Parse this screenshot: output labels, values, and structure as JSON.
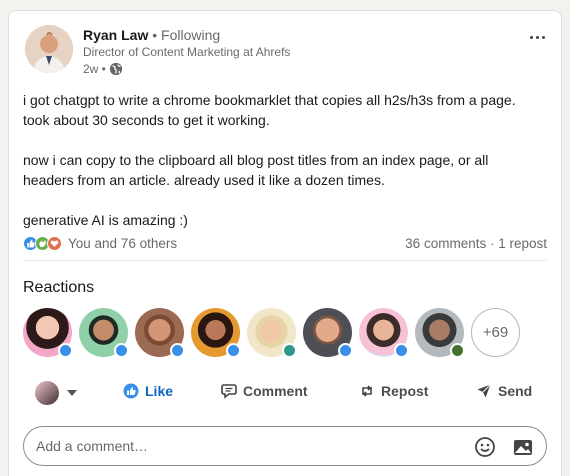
{
  "post": {
    "author_name": "Ryan Law",
    "following": "• Following",
    "headline": "Director of Content Marketing at Ahrefs",
    "time": "2w •",
    "visibility_icon": "globe-icon",
    "body": [
      "i got chatgpt to write a chrome bookmarklet that copies all h2s/h3s from a page. took about 30 seconds to get it working.",
      "now i can copy to the clipboard all blog post titles from an index page, or all headers from an article. already used it like a dozen times.",
      "generative AI is amazing :)"
    ],
    "body_lines": [
      "i got chatgpt to write a chrome bookmarklet that copies all h2s/h3s from a page.",
      "took about 30 seconds to get it working.",
      "now i can copy to the clipboard all blog post titles from an index page, or all",
      "headers from an article. already used it like a dozen times.",
      "generative AI is amazing :)"
    ]
  },
  "social": {
    "reactors": "You and 76 others",
    "comments": "36 comments",
    "separator": " · ",
    "reposts": "1 repost",
    "reaction_types": [
      "like",
      "celebrate",
      "love"
    ]
  },
  "reactions": {
    "title": "Reactions",
    "more_count": "+69"
  },
  "actions": {
    "like": "Like",
    "comment": "Comment",
    "repost": "Repost",
    "send": "Send"
  },
  "comment_box": {
    "placeholder": "Add a comment…",
    "emoji_icon": "emoji-icon",
    "image_icon": "image-icon"
  },
  "colors": {
    "accent": "#0a66c2",
    "like": "#378fe9",
    "celebrate": "#6dae4f",
    "love": "#df704d"
  }
}
